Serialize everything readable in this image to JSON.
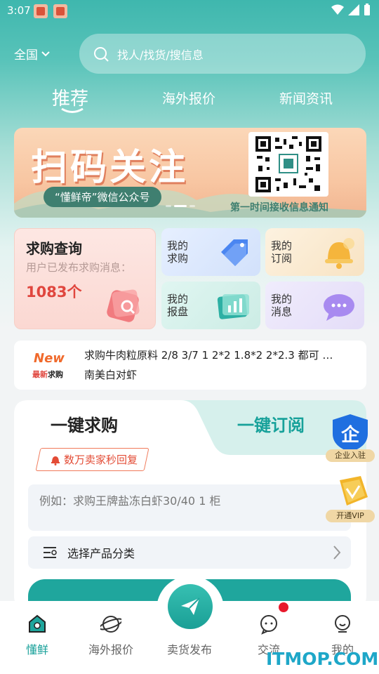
{
  "status_bar": {
    "time": "3:07"
  },
  "header": {
    "region": "全国",
    "search_placeholder": "找人/找货/搜信息"
  },
  "top_tabs": [
    {
      "label": "推荐",
      "active": true
    },
    {
      "label": "海外报价",
      "active": false
    },
    {
      "label": "新闻资讯",
      "active": false
    }
  ],
  "banner": {
    "title": "扫码关注",
    "pill": "“懂鲜帝”微信公众号",
    "subtitle": "第一时间接收信息通知"
  },
  "purchase_card": {
    "title": "求购查询",
    "subtitle": "用户已发布求购消息：",
    "count": "1083个"
  },
  "quick_links": [
    {
      "label": "我的求购",
      "icon": "tag-icon"
    },
    {
      "label": "我的订阅",
      "icon": "bell-icon"
    },
    {
      "label": "我的报盘",
      "icon": "chart-icon"
    },
    {
      "label": "我的消息",
      "icon": "chat-icon"
    }
  ],
  "news": {
    "badge_new": "New",
    "badge_sub_red": "最新",
    "badge_sub_black": "求购",
    "lines": [
      "求购牛肉粒原料 2/8 3/7 1 2*2 1.8*2 2*2.3 都可 …",
      "南美白对虾"
    ]
  },
  "form": {
    "tab_buy": "一键求购",
    "tab_subscribe": "一键订阅",
    "badge": "数万卖家秒回复",
    "textarea_placeholder": "例如：求购王牌盐冻白虾30/40 1 柜",
    "select_label": "选择产品分类"
  },
  "floating": {
    "enterprise": "企业入驻",
    "vip": "开通VIP"
  },
  "bottom_nav": [
    {
      "label": "懂鲜",
      "active": true
    },
    {
      "label": "海外报价",
      "active": false
    },
    {
      "label": "卖货发布",
      "active": false
    },
    {
      "label": "交流",
      "active": false
    },
    {
      "label": "我的",
      "active": false
    }
  ],
  "watermark": "ITMOP.COM",
  "colors": {
    "primary": "#1fa69d",
    "accent_red": "#e0463e",
    "vip_gold": "#f0d7a5"
  }
}
